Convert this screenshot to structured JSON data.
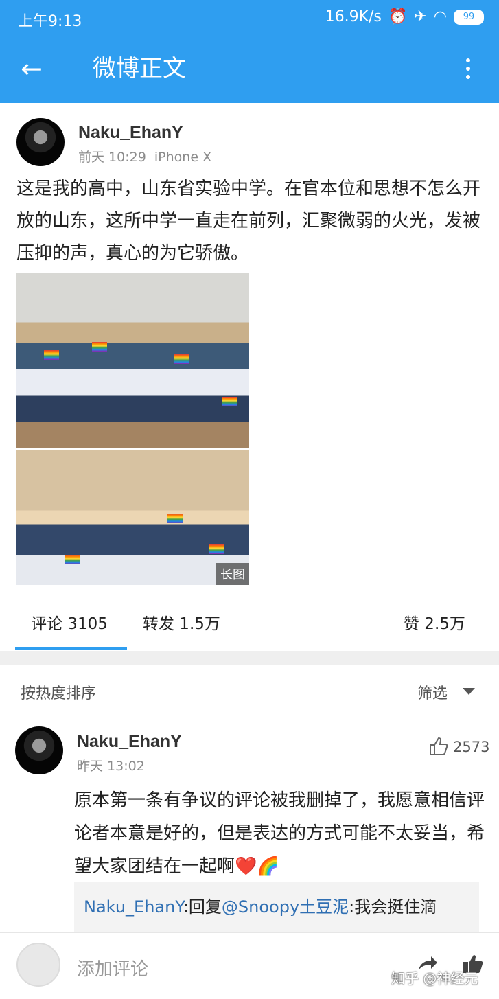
{
  "status_bar": {
    "time": "上午9:13",
    "speed": "16.9K/s",
    "battery": "99"
  },
  "header": {
    "title": "微博正文"
  },
  "post": {
    "username": "Naku_EhanY",
    "time": "前天 10:29",
    "device": "iPhone X",
    "text": "这是我的高中，山东省实验中学。在官本位和思想不怎么开放的山东，这所中学一直走在前列，汇聚微弱的火光，发被压抑的声，真心的为它骄傲。",
    "image_badge": "长图"
  },
  "tabs": {
    "comments": "评论 3105",
    "reposts": "转发 1.5万",
    "likes": "赞 2.5万"
  },
  "sort": {
    "label": "按热度排序",
    "filter": "筛选"
  },
  "comment": {
    "username": "Naku_EhanY",
    "time": "昨天 13:02",
    "likes": "2573",
    "text": "原本第一条有争议的评论被我删掉了，我愿意相信评论者本意是好的，但是表达的方式可能不太妥当，希望大家团结在一起啊❤️🌈",
    "reply": {
      "author": "Naku_EhanY",
      "action": ":回复",
      "mention": "@Snoopy土豆泥",
      "text": ":我会挺住滴"
    }
  },
  "bottom_bar": {
    "placeholder": "添加评论",
    "watermark": "知乎 @神经元"
  },
  "colors": {
    "accent": "#2f9ef0",
    "link": "#2f6fb3"
  }
}
